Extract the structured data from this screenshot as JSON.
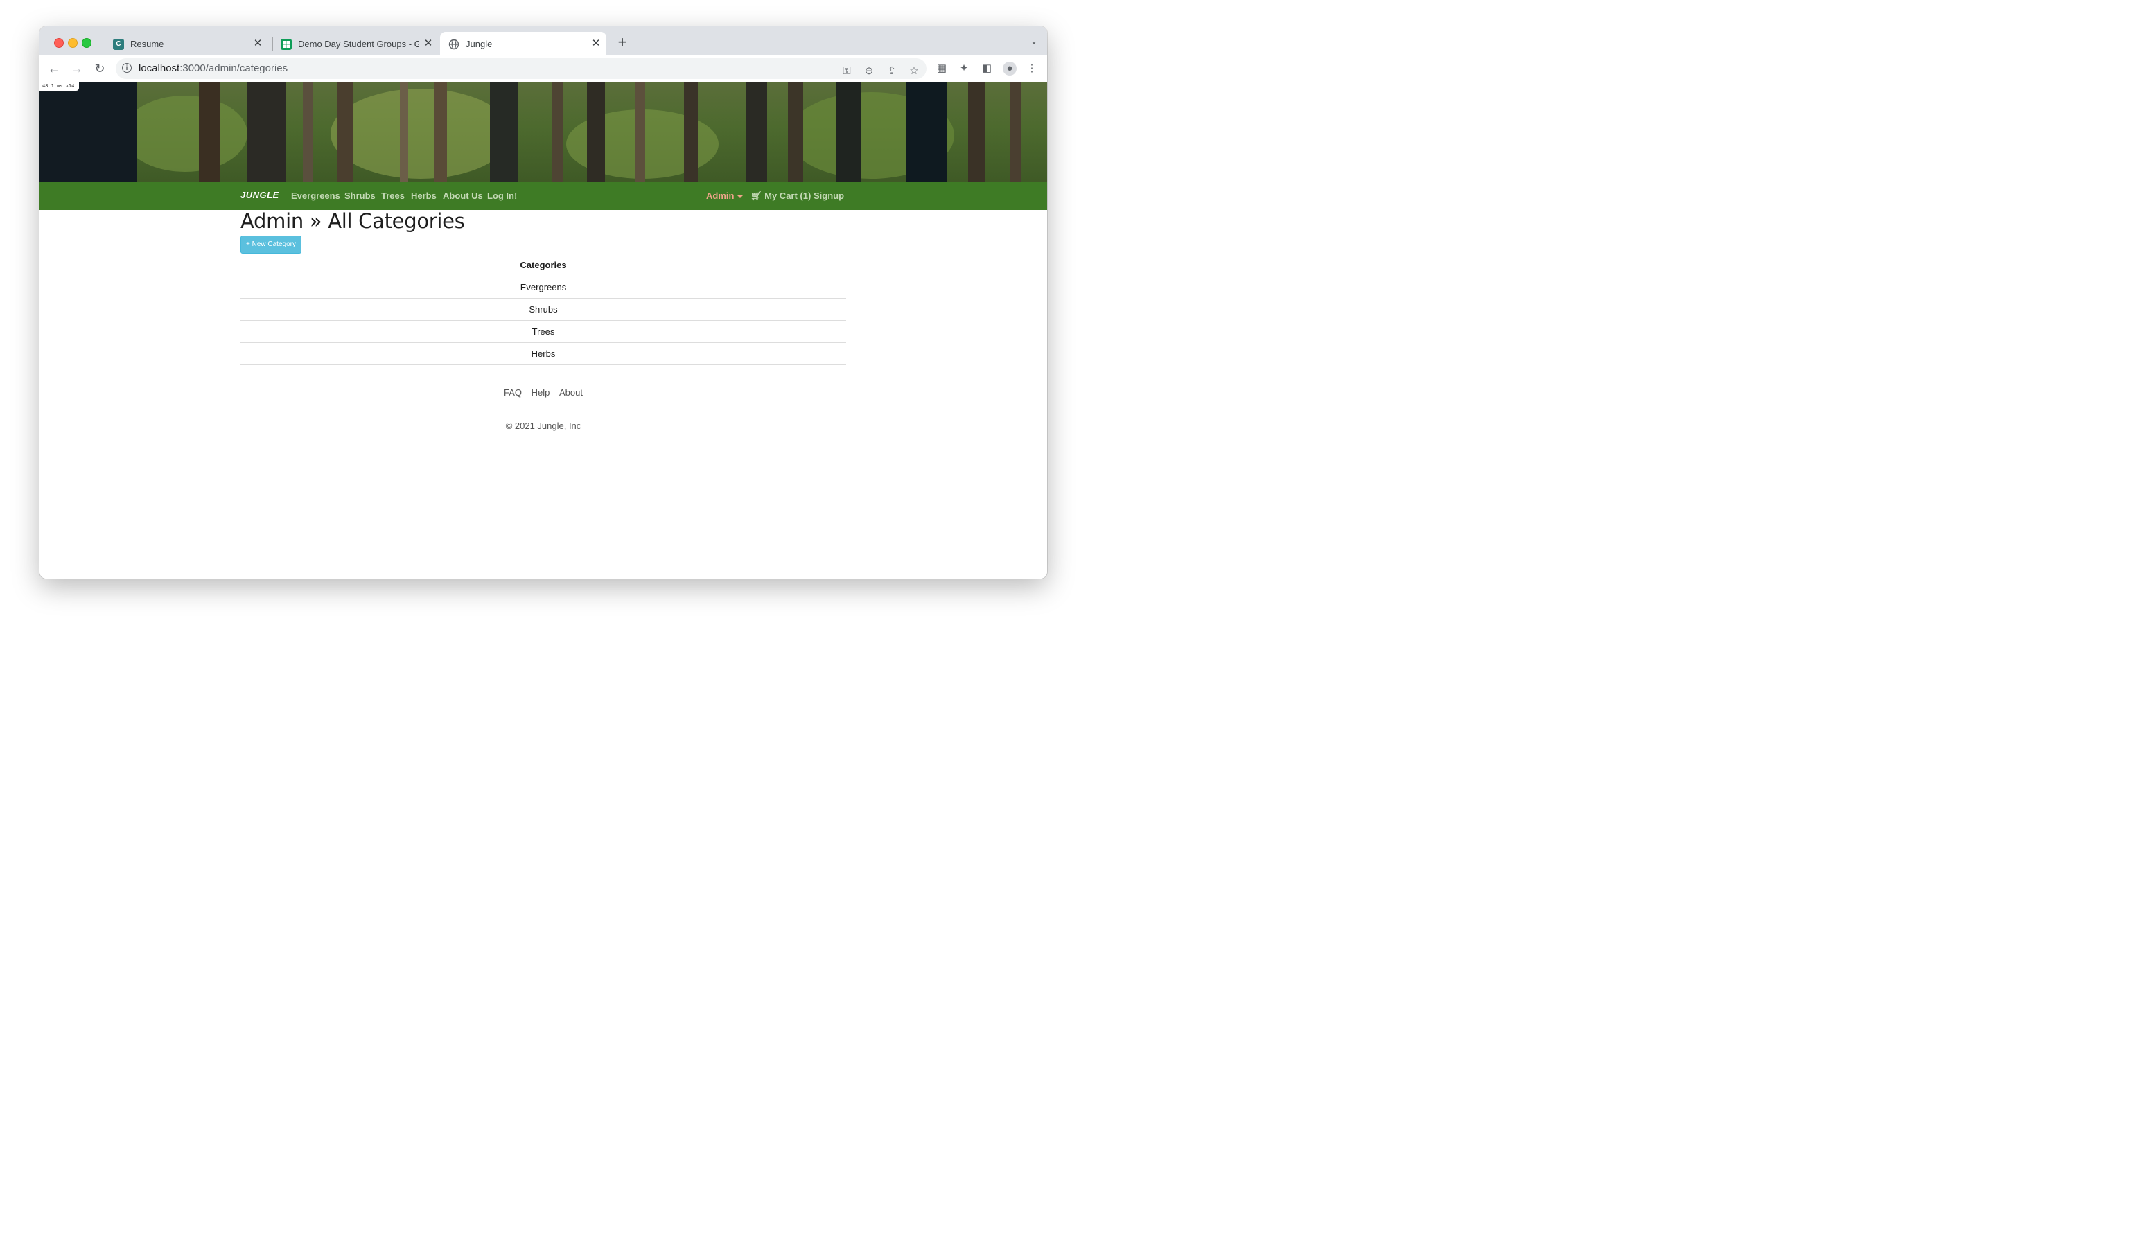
{
  "browser": {
    "tabs": [
      {
        "title": "Resume",
        "favicon": "c-letter-icon",
        "favicon_color": "#2d7d7d",
        "active": false
      },
      {
        "title": "Demo Day Student Groups - Google Sheets",
        "favicon": "sheets-icon",
        "favicon_color": "#0f9d58",
        "active": false
      },
      {
        "title": "Jungle",
        "favicon": "globe-icon",
        "favicon_color": "#5f6368",
        "active": true
      }
    ],
    "url_host": "localhost",
    "url_path": ":3000/admin/categories",
    "perf_badge": "48.1 ms ×14"
  },
  "nav": {
    "brand": "JUNGLE",
    "links": [
      "Evergreens",
      "Shrubs",
      "Trees",
      "Herbs",
      "About Us",
      "Log In!"
    ],
    "admin_label": "Admin",
    "cart_label": "My Cart (1)",
    "signup_label": "Signup",
    "bar_color": "#3e7b25",
    "admin_color": "#f1a58c"
  },
  "main": {
    "title": "Admin » All Categories",
    "new_category_label": "+ New Category",
    "table_header": "Categories",
    "categories": [
      "Evergreens",
      "Shrubs",
      "Trees",
      "Herbs"
    ]
  },
  "footer": {
    "links": [
      "FAQ",
      "Help",
      "About"
    ],
    "copyright": "© 2021 Jungle, Inc"
  }
}
